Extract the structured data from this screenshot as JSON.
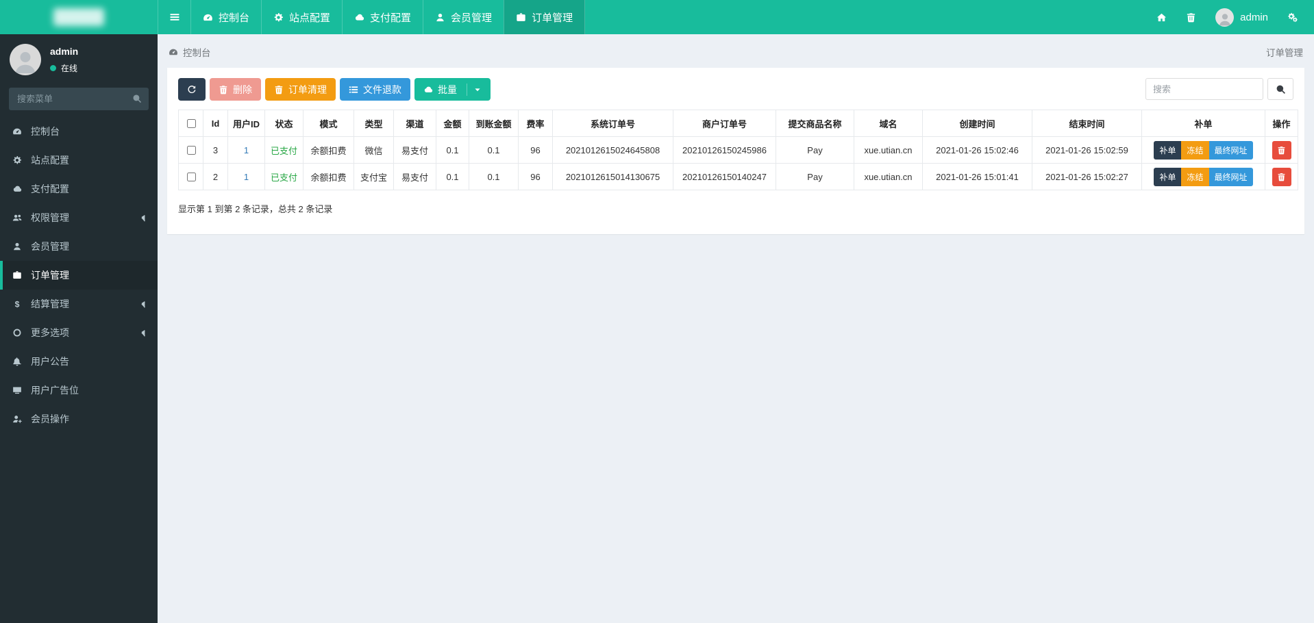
{
  "navbar": {
    "items": [
      {
        "icon": "tachometer-icon",
        "label": "控制台",
        "active": false
      },
      {
        "icon": "gear-icon",
        "label": "站点配置",
        "active": false
      },
      {
        "icon": "cloud-icon",
        "label": "支付配置",
        "active": false
      },
      {
        "icon": "user-icon",
        "label": "会员管理",
        "active": false
      },
      {
        "icon": "briefcase-icon",
        "label": "订单管理",
        "active": true
      }
    ],
    "right": {
      "username": "admin"
    }
  },
  "sidebar": {
    "user": {
      "name": "admin",
      "status_label": "在线"
    },
    "search_placeholder": "搜索菜单",
    "items": [
      {
        "icon": "tachometer-icon",
        "label": "控制台",
        "active": false,
        "has_submenu": false
      },
      {
        "icon": "gear-icon",
        "label": "站点配置",
        "active": false,
        "has_submenu": false
      },
      {
        "icon": "cloud-icon",
        "label": "支付配置",
        "active": false,
        "has_submenu": false
      },
      {
        "icon": "users-icon",
        "label": "权限管理",
        "active": false,
        "has_submenu": true
      },
      {
        "icon": "user-icon",
        "label": "会员管理",
        "active": false,
        "has_submenu": false
      },
      {
        "icon": "briefcase-icon",
        "label": "订单管理",
        "active": true,
        "has_submenu": false
      },
      {
        "icon": "dollar-icon",
        "label": "结算管理",
        "active": false,
        "has_submenu": true
      },
      {
        "icon": "circle-o-icon",
        "label": "更多选项",
        "active": false,
        "has_submenu": true
      },
      {
        "icon": "bell-icon",
        "label": "用户公告",
        "active": false,
        "has_submenu": false
      },
      {
        "icon": "tv-icon",
        "label": "用户广告位",
        "active": false,
        "has_submenu": false
      },
      {
        "icon": "user-plus-icon",
        "label": "会员操作",
        "active": false,
        "has_submenu": false
      }
    ]
  },
  "content": {
    "breadcrumb": {
      "icon": "tachometer-icon",
      "label": "控制台",
      "right_label": "订单管理"
    },
    "toolbar": {
      "buttons": [
        {
          "name": "refresh",
          "icon": "refresh-icon",
          "label": "",
          "color": "#2c3e50"
        },
        {
          "name": "delete",
          "icon": "trash-icon",
          "label": "删除",
          "color": "#ef9a91"
        },
        {
          "name": "order-clean",
          "icon": "trash-icon",
          "label": "订单清理",
          "color": "#f39c12"
        },
        {
          "name": "file-refund",
          "icon": "list-icon",
          "label": "文件退款",
          "color": "#3498db"
        },
        {
          "name": "batch",
          "icon": "cloud-icon",
          "label": "批量",
          "color": "#18bc9c",
          "caret": true
        }
      ],
      "search_placeholder": "搜索"
    },
    "table": {
      "columns": [
        "Id",
        "用户ID",
        "状态",
        "模式",
        "类型",
        "渠道",
        "金额",
        "到账金额",
        "费率",
        "系统订单号",
        "商户订单号",
        "提交商品名称",
        "域名",
        "创建时间",
        "结束时间",
        "补单",
        "操作"
      ],
      "rows": [
        {
          "id": "3",
          "user_id": "1",
          "status": "已支付",
          "mode": "余额扣费",
          "type": "微信",
          "channel": "易支付",
          "amount": "0.1",
          "arrival": "0.1",
          "rate": "96",
          "sys_order_no": "2021012615024645808",
          "merchant_order_no": "20210126150245986",
          "product": "Pay",
          "domain": "xue.utian.cn",
          "created_at": "2021-01-26 15:02:46",
          "ended_at": "2021-01-26 15:02:59",
          "supplement_buttons": [
            "补单",
            "冻结",
            "最终网址"
          ]
        },
        {
          "id": "2",
          "user_id": "1",
          "status": "已支付",
          "mode": "余额扣费",
          "type": "支付宝",
          "channel": "易支付",
          "amount": "0.1",
          "arrival": "0.1",
          "rate": "96",
          "sys_order_no": "2021012615014130675",
          "merchant_order_no": "20210126150140247",
          "product": "Pay",
          "domain": "xue.utian.cn",
          "created_at": "2021-01-26 15:01:41",
          "ended_at": "2021-01-26 15:02:27",
          "supplement_buttons": [
            "补单",
            "冻结",
            "最终网址"
          ]
        }
      ]
    },
    "summary": "显示第 1 到第 2 条记录，总共 2 条记录"
  },
  "colors": {
    "navbar": "#18bc9c",
    "navbar_active": "#15a589",
    "sidebar": "#222d32",
    "sidebar_active": "#1e282c",
    "sidebar_accent": "#18bc9c",
    "status_paid": "#28a745",
    "link": "#337ab7",
    "supplement": [
      "#2c3e50",
      "#f39c12",
      "#3498db"
    ],
    "row_delete": "#e74c3c"
  }
}
